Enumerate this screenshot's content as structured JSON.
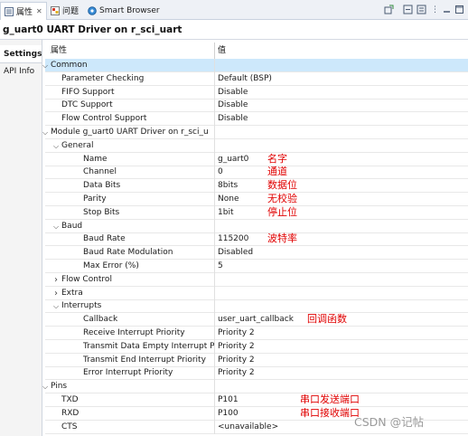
{
  "tabs": [
    {
      "label": "属性",
      "active": true,
      "icon": "properties-icon"
    },
    {
      "label": "问题",
      "active": false,
      "icon": "problems-icon"
    },
    {
      "label": "Smart Browser",
      "active": false,
      "icon": "smart-browser-icon"
    }
  ],
  "toolbar_icons": [
    "pin-view-icon",
    "new-view-icon",
    "collapse-icon",
    "menu-icon",
    "minimize-icon",
    "maximize-icon"
  ],
  "title": "g_uart0 UART Driver on r_sci_uart",
  "left_nav": [
    {
      "label": "Settings",
      "selected": true
    },
    {
      "label": "API Info",
      "selected": false
    }
  ],
  "columns": {
    "property": "属性",
    "value": "值"
  },
  "rows": [
    {
      "name": "Common",
      "value": "",
      "level": 0,
      "expander": "expanded",
      "selected": true
    },
    {
      "name": "Parameter Checking",
      "value": "Default (BSP)",
      "level": 1,
      "expander": ""
    },
    {
      "name": "FIFO Support",
      "value": "Disable",
      "level": 1,
      "expander": ""
    },
    {
      "name": "DTC Support",
      "value": "Disable",
      "level": 1,
      "expander": ""
    },
    {
      "name": "Flow Control Support",
      "value": "Disable",
      "level": 1,
      "expander": ""
    },
    {
      "name": "Module g_uart0 UART Driver on r_sci_u",
      "value": "",
      "level": 0,
      "expander": "expanded"
    },
    {
      "name": "General",
      "value": "",
      "level": 1,
      "expander": "expanded"
    },
    {
      "name": "Name",
      "value": "g_uart0",
      "level": 2,
      "expander": ""
    },
    {
      "name": "Channel",
      "value": "0",
      "level": 2,
      "expander": ""
    },
    {
      "name": "Data Bits",
      "value": "8bits",
      "level": 2,
      "expander": ""
    },
    {
      "name": "Parity",
      "value": "None",
      "level": 2,
      "expander": ""
    },
    {
      "name": "Stop Bits",
      "value": "1bit",
      "level": 2,
      "expander": ""
    },
    {
      "name": "Baud",
      "value": "",
      "level": 1,
      "expander": "expanded"
    },
    {
      "name": "Baud Rate",
      "value": "115200",
      "level": 2,
      "expander": ""
    },
    {
      "name": "Baud Rate Modulation",
      "value": "Disabled",
      "level": 2,
      "expander": ""
    },
    {
      "name": "Max Error (%)",
      "value": "5",
      "level": 2,
      "expander": ""
    },
    {
      "name": "Flow Control",
      "value": "",
      "level": 1,
      "expander": "collapsed"
    },
    {
      "name": "Extra",
      "value": "",
      "level": 1,
      "expander": "collapsed"
    },
    {
      "name": "Interrupts",
      "value": "",
      "level": 1,
      "expander": "expanded"
    },
    {
      "name": "Callback",
      "value": "user_uart_callback",
      "level": 2,
      "expander": ""
    },
    {
      "name": "Receive Interrupt Priority",
      "value": "Priority 2",
      "level": 2,
      "expander": ""
    },
    {
      "name": "Transmit Data Empty Interrupt Pri",
      "value": "Priority 2",
      "level": 2,
      "expander": ""
    },
    {
      "name": "Transmit End Interrupt Priority",
      "value": "Priority 2",
      "level": 2,
      "expander": ""
    },
    {
      "name": "Error Interrupt Priority",
      "value": "Priority 2",
      "level": 2,
      "expander": ""
    },
    {
      "name": "Pins",
      "value": "",
      "level": 0,
      "expander": "expanded"
    },
    {
      "name": "TXD",
      "value": "P101",
      "level": 1,
      "expander": ""
    },
    {
      "name": "RXD",
      "value": "P100",
      "level": 1,
      "expander": ""
    },
    {
      "name": "CTS",
      "value": "<unavailable>",
      "level": 1,
      "expander": ""
    }
  ],
  "annotations": [
    {
      "row": "Name",
      "text": "名字"
    },
    {
      "row": "Channel",
      "text": "通道"
    },
    {
      "row": "Data Bits",
      "text": "数据位"
    },
    {
      "row": "Parity",
      "text": "无校验"
    },
    {
      "row": "Stop Bits",
      "text": "停止位"
    },
    {
      "row": "Baud Rate",
      "text": "波特率"
    },
    {
      "row": "Callback",
      "text": "回调函数"
    },
    {
      "row": "TXD",
      "text": "串口发送端口"
    },
    {
      "row": "RXD",
      "text": "串口接收端口"
    }
  ],
  "watermark": "CSDN @记帖",
  "colors": {
    "selected_row": "#cde8fb",
    "annotation": "#e00000",
    "tab_bar": "#eef1f6"
  }
}
